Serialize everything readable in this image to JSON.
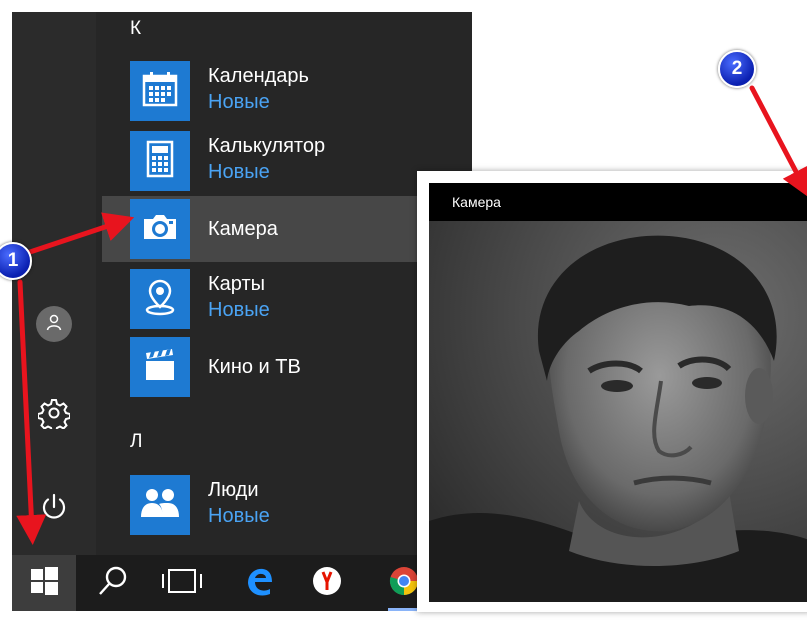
{
  "start_menu": {
    "section_k": "К",
    "section_l": "Л",
    "apps": [
      {
        "name": "Календарь",
        "subtitle": "Новые",
        "icon": "calendar-icon"
      },
      {
        "name": "Калькулятор",
        "subtitle": "Новые",
        "icon": "calculator-icon"
      },
      {
        "name": "Камера",
        "subtitle": "",
        "icon": "camera-icon"
      },
      {
        "name": "Карты",
        "subtitle": "Новые",
        "icon": "maps-pin-icon"
      },
      {
        "name": "Кино и ТВ",
        "subtitle": "",
        "icon": "clapperboard-icon"
      },
      {
        "name": "Люди",
        "subtitle": "Новые",
        "icon": "people-icon"
      }
    ],
    "rail_icons": [
      "user-icon",
      "gear-icon",
      "power-icon"
    ]
  },
  "taskbar": {
    "icons": [
      "windows-logo-icon",
      "search-icon",
      "task-view-icon",
      "edge-icon",
      "yandex-icon",
      "chrome-icon"
    ]
  },
  "camera_window": {
    "title": "Камера"
  },
  "markers": {
    "one": "1",
    "two": "2"
  },
  "colors": {
    "tile_blue": "#1e7ad2",
    "subtitle_blue": "#4aa3f3",
    "arrow_red": "#e8141e",
    "marker_blue": "#0a1fb0"
  }
}
